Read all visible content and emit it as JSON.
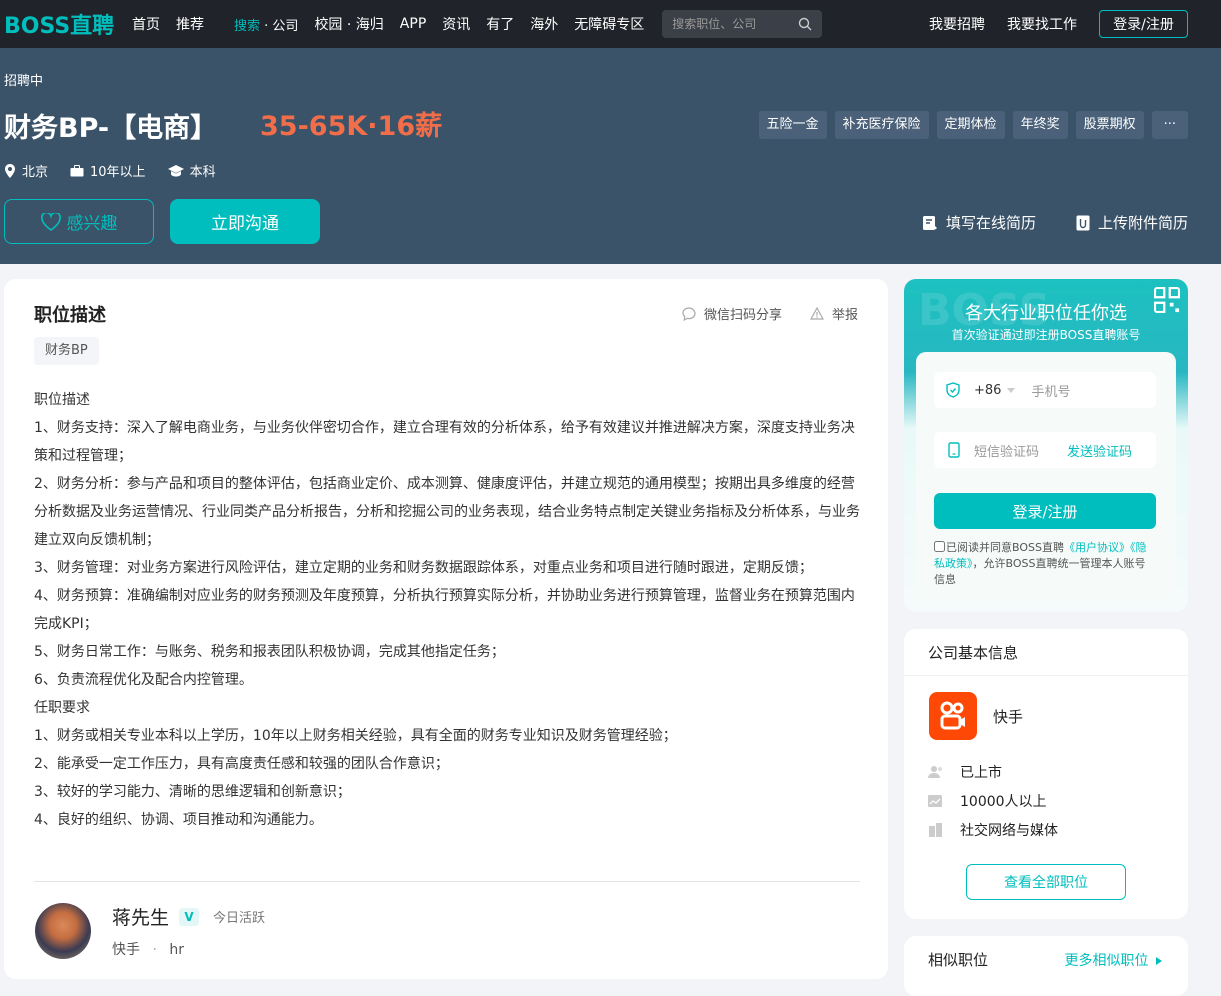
{
  "nav": {
    "logo": "BOSS直聘",
    "items": [
      "首页",
      "推荐"
    ],
    "search_label": "搜索",
    "company_label": "公司",
    "campus_label": "校园",
    "overseas_return_label": "海归",
    "items2": [
      "APP",
      "资讯",
      "有了",
      "海外",
      "无障碍专区"
    ],
    "search_placeholder": "搜索职位、公司",
    "recruit": "我要招聘",
    "findjob": "我要找工作",
    "login": "登录/注册"
  },
  "job": {
    "status": "招聘中",
    "title": "财务BP-【电商】",
    "salary": "35-65K·16薪",
    "benefits": [
      "五险一金",
      "补充医疗保险",
      "定期体检",
      "年终奖",
      "股票期权",
      "···"
    ],
    "city": "北京",
    "experience": "10年以上",
    "degree": "本科",
    "interest_btn": "感兴趣",
    "chat_btn": "立即沟通",
    "online_resume": "填写在线简历",
    "upload_resume": "上传附件简历"
  },
  "detail": {
    "heading": "职位描述",
    "wechat_share": "微信扫码分享",
    "report": "举报",
    "skill_tag": "财务BP",
    "lines": [
      "职位描述",
      "1、财务支持：深入了解电商业务，与业务伙伴密切合作，建立合理有效的分析体系，给予有效建议并推进解决方案，深度支持业务决策和过程管理；",
      "2、财务分析：参与产品和项目的整体评估，包括商业定价、成本测算、健康度评估，并建立规范的通用模型；按期出具多维度的经营分析数据及业务运营情况、行业同类产品分析报告，分析和挖掘公司的业务表现，结合业务特点制定关键业务指标及分析体系，与业务建立双向反馈机制；",
      "3、财务管理：对业务方案进行风险评估，建立定期的业务和财务数据跟踪体系，对重点业务和项目进行随时跟进，定期反馈；",
      "4、财务预算：准确编制对应业务的财务预测及年度预算，分析执行预算实际分析，并协助业务进行预算管理，监督业务在预算范围内完成KPI；",
      "5、财务日常工作：与账务、税务和报表团队积极协调，完成其他指定任务；",
      "6、负责流程优化及配合内控管理。",
      "任职要求",
      "1、财务或相关专业本科以上学历，10年以上财务相关经验，具有全面的财务专业知识及财务管理经验；",
      "2、能承受一定工作压力，具有高度责任感和较强的团队合作意识；",
      "3、较好的学习能力、清晰的思维逻辑和创新意识；",
      "4、良好的组织、协调、项目推动和沟通能力。"
    ]
  },
  "recruiter": {
    "name": "蒋先生",
    "verified": "V",
    "active": "今日活跃",
    "company": "快手",
    "sep": "·",
    "role": "hr"
  },
  "register": {
    "bg_text": "BOSS",
    "title": "各大行业职位任你选",
    "subtitle": "首次验证通过即注册BOSS直聘账号",
    "country_code": "+86",
    "phone_placeholder": "手机号",
    "sms_placeholder": "短信验证码",
    "send_code": "发送验证码",
    "login_btn": "登录/注册",
    "agree_prefix": "已阅读并同意BOSS直聘",
    "user_agreement": "《用户协议》",
    "privacy_policy": "《隐私政策》",
    "agree_suffix": "，允许BOSS直聘统一管理本人账号信息"
  },
  "company": {
    "heading": "公司基本信息",
    "name": "快手",
    "stage": "已上市",
    "size": "10000人以上",
    "industry": "社交网络与媒体",
    "all_jobs": "查看全部职位",
    "brand_color": "#fe4906"
  },
  "similar": {
    "heading": "相似职位",
    "more": "更多相似职位"
  },
  "colors": {
    "accent": "#00bebd",
    "salary": "#f26d49",
    "hero_bg": "#3b5369",
    "nav_bg": "#202329"
  }
}
